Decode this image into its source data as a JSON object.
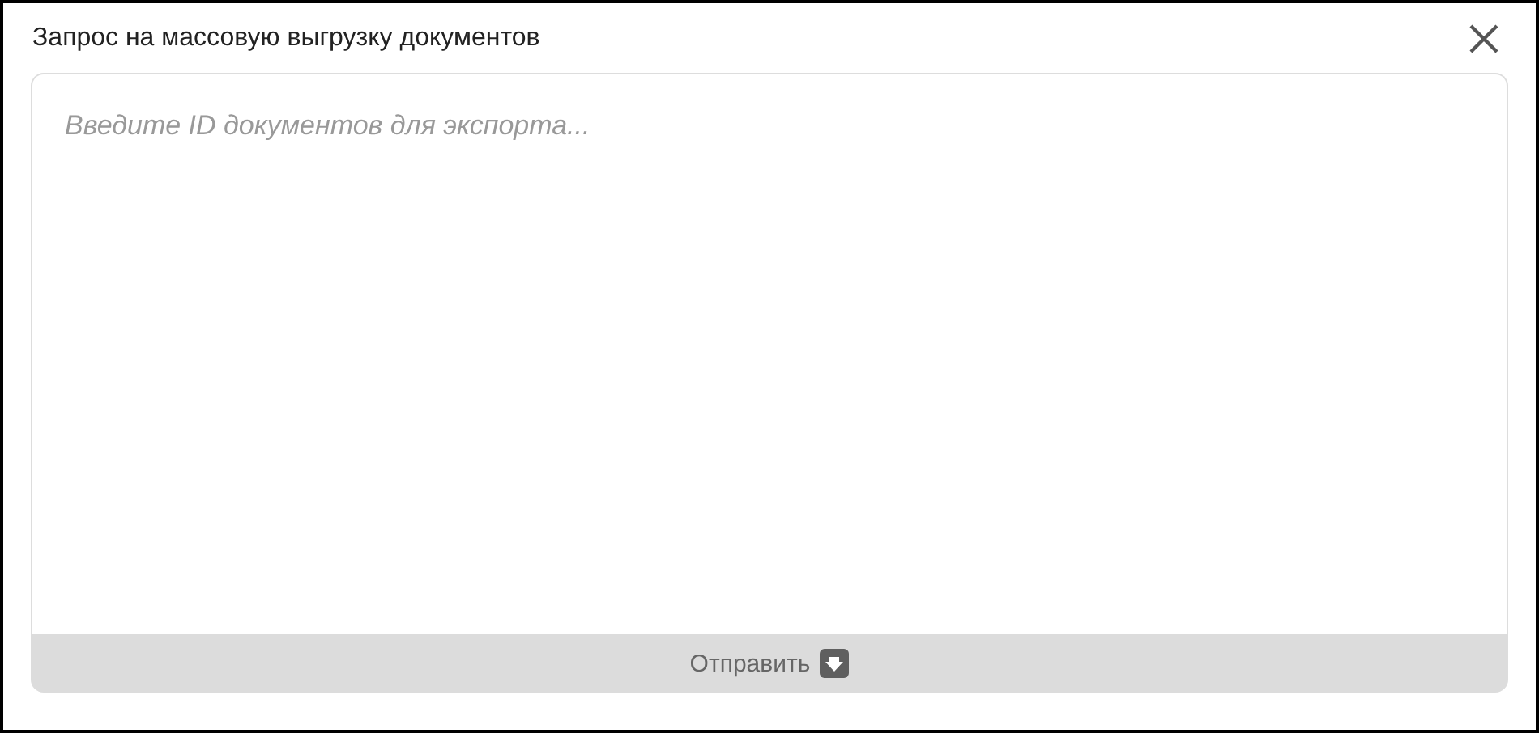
{
  "dialog": {
    "title": "Запрос на массовую выгрузку документов"
  },
  "input": {
    "placeholder": "Введите ID документов для экспорта..."
  },
  "submit_button": {
    "label": "Отправить"
  }
}
